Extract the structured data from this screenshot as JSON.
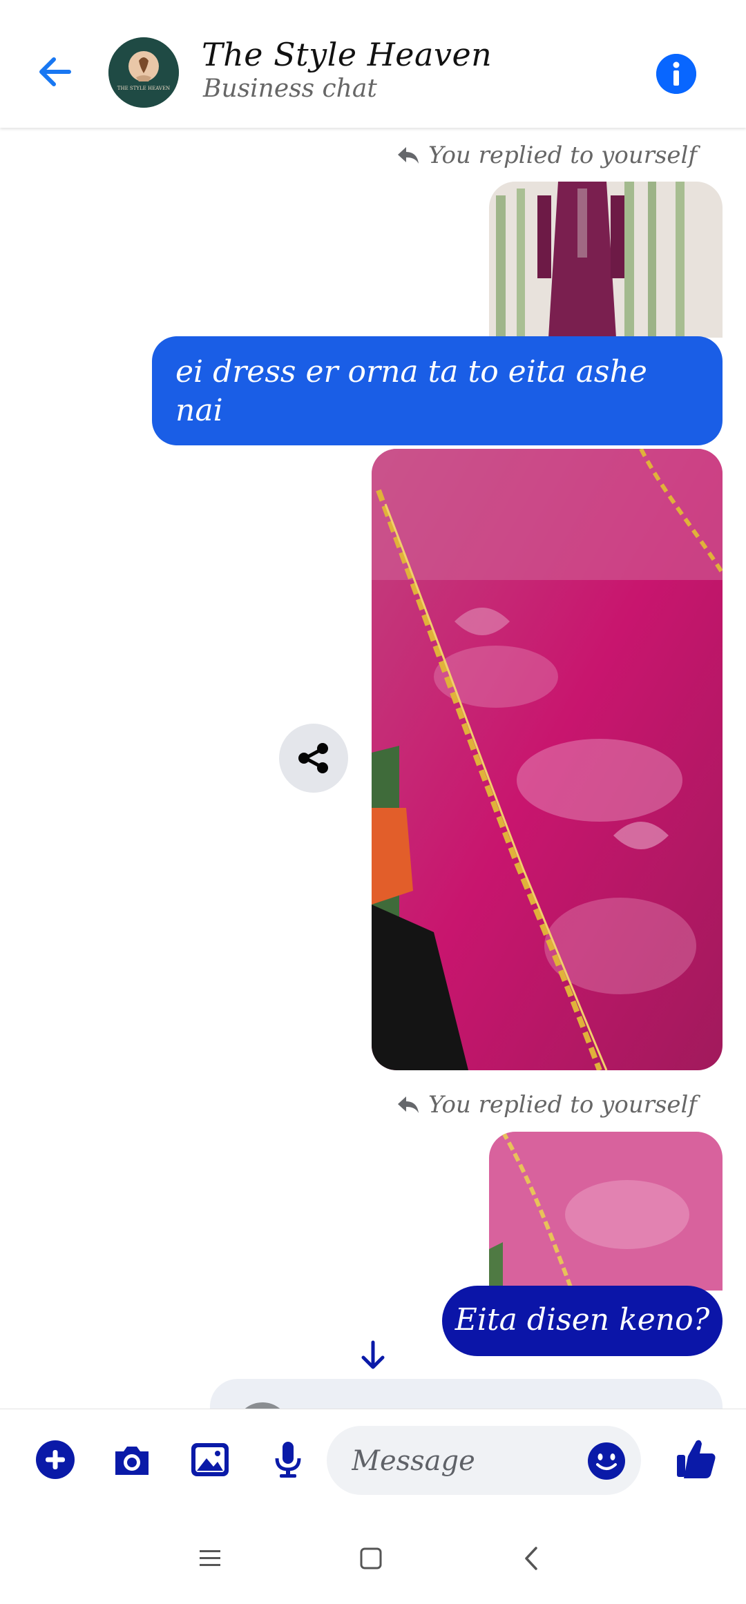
{
  "header": {
    "title": "The Style Heaven",
    "subtitle": "Business chat",
    "avatar_text": "THE STYLE HEAVEN"
  },
  "messages": {
    "reply_note_1": "You replied to yourself",
    "bubble_1": "ei dress er orna ta to eita ashe nai",
    "reply_note_2": "You replied to yourself",
    "bubble_2": "Eita disen keno?"
  },
  "composer": {
    "placeholder": "Message"
  },
  "colors": {
    "accent": "#0866ff",
    "bubble_blue": "#1a5ee6",
    "bubble_dark": "#0b15a8",
    "icon_dark": "#0a1aa8"
  }
}
